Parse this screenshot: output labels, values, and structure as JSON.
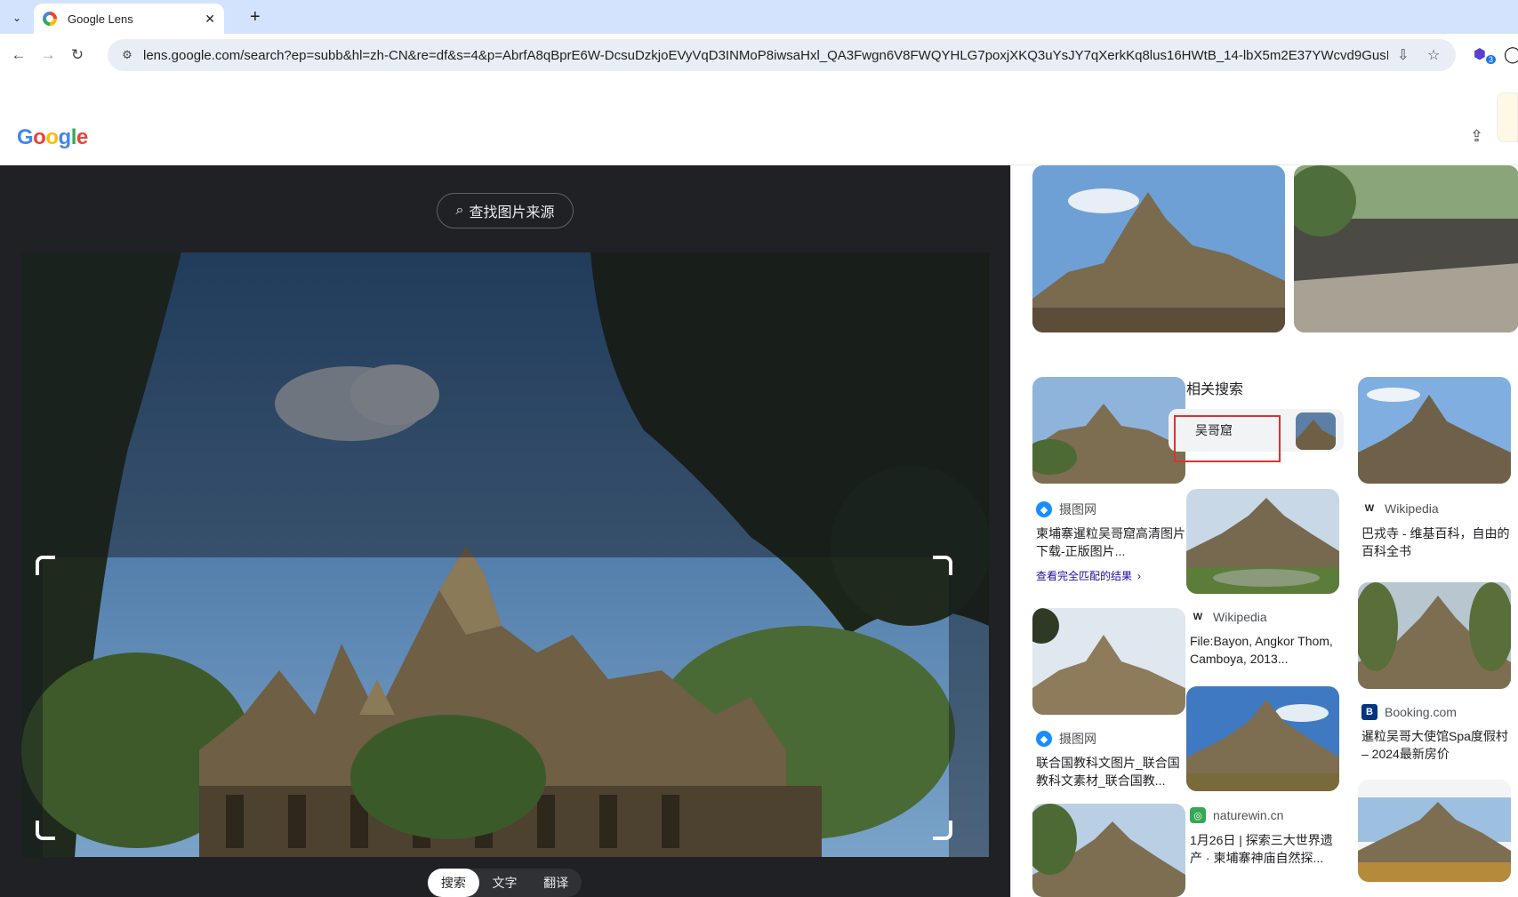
{
  "browser": {
    "tab_title": "Google Lens",
    "tab_close": "✕",
    "new_tab": "+",
    "tab_menu": "⌄",
    "url": "lens.google.com/search?ep=subb&hl=zh-CN&re=df&s=4&p=AbrfA8qBprE6W-DcsuDzkjoEVyVqD3INMoP8iwsaHxl_QA3Fwgn6V8FWQYHLG7poxjXKQ3uYsJY7qXerkKq8lus16HWtB_14-lbX5m2E37YWcvd9GusB...",
    "back_icon": "←",
    "forward_icon": "→",
    "reload_icon": "↻",
    "site_info_icon": "⚙",
    "install_icon": "⇩",
    "bookmark_icon": "☆",
    "extension_badge": "3"
  },
  "header": {
    "logo": "Google",
    "share_icon": "⇪"
  },
  "lens": {
    "find_source_label": "查找图片来源",
    "find_source_icon": "⌕",
    "modes": [
      "搜索",
      "文字",
      "翻译"
    ],
    "active_mode": "搜索"
  },
  "results": {
    "related_title": "相关搜索",
    "related_chip": "吴哥窟",
    "items": [
      {
        "site": "摄图网",
        "title": "柬埔寨暹粒吴哥窟高清图片下载-正版图片...",
        "link": "查看完全匹配的结果"
      },
      {
        "site": "Wikipedia",
        "title": "巴戎寺 - 维基百科，自由的百科全书"
      },
      {
        "site": "Wikipedia",
        "title": "File:Bayon, Angkor Thom, Camboya, 2013..."
      },
      {
        "site": "摄图网",
        "title": "联合国教科文图片_联合国教科文素材_联合国教..."
      },
      {
        "site": "Booking.com",
        "title": "暹粒吴哥大使馆Spa度假村 – 2024最新房价"
      },
      {
        "site": "naturewin.cn",
        "title": "1月26日 | 探索三大世界遗产 · 柬埔寨神庙自然探..."
      }
    ]
  },
  "colors": {
    "accent_blue": "#1a73e8",
    "highlight_red": "#e03131"
  }
}
